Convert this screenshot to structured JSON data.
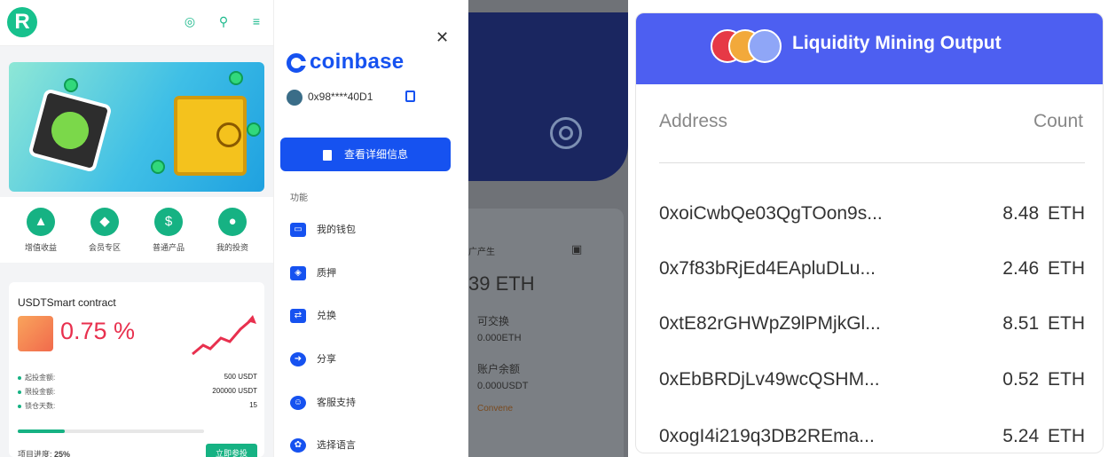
{
  "panel1": {
    "logo_letter": "R",
    "nav": [
      {
        "label": "增值收益",
        "icon": "chart-icon"
      },
      {
        "label": "会员专区",
        "icon": "diamond-icon"
      },
      {
        "label": "普通产品",
        "icon": "money-bag-icon"
      },
      {
        "label": "我的投资",
        "icon": "coin-icon"
      }
    ],
    "card": {
      "title": "USDTSmart contract",
      "rate": "0.75 %",
      "rows": [
        {
          "label": "起投金额:",
          "value": "500 USDT"
        },
        {
          "label": "限投金额:",
          "value": "200000 USDT"
        },
        {
          "label": "锁仓天数:",
          "value": "15"
        }
      ],
      "progress_label": "项目进度:",
      "progress_value": "25%",
      "progress_fraction": 0.25,
      "buy_label": "立即参投"
    }
  },
  "panel2": {
    "brand": "coinbase",
    "address": "0x98****40D1",
    "detail_button": "查看详细信息",
    "section": "功能",
    "menu": [
      {
        "label": "我的钱包",
        "icon": "wallet-icon"
      },
      {
        "label": "质押",
        "icon": "pledge-icon"
      },
      {
        "label": "兑换",
        "icon": "exchange-icon"
      },
      {
        "label": "分享",
        "icon": "share-icon"
      },
      {
        "label": "客服支持",
        "icon": "support-icon"
      },
      {
        "label": "选择语言",
        "icon": "language-icon"
      }
    ]
  },
  "panel3": {
    "label_a": "广产生",
    "amount": "39 ETH",
    "ex_label": "可交换",
    "ex_value": "0.000ETH",
    "bal_label": "账户余额",
    "bal_value": "0.000USDT",
    "extra": "Convene"
  },
  "panel4": {
    "title": "Liquidity Mining Output",
    "col_address": "Address",
    "col_count": "Count",
    "rows": [
      {
        "address": "0xoiCwbQe03QgTOon9s...",
        "count": "8.48 ETH"
      },
      {
        "address": "0x7f83bRjEd4EApluDLu...",
        "count": "2.46 ETH"
      },
      {
        "address": "0xtE82rGHWpZ9lPMjkGl...",
        "count": "8.51 ETH"
      },
      {
        "address": "0xEbBRDjLv49wcQSHM...",
        "count": "0.52 ETH"
      },
      {
        "address": "0xogI4i219q3DB2REma...",
        "count": "5.24 ETH"
      }
    ]
  }
}
